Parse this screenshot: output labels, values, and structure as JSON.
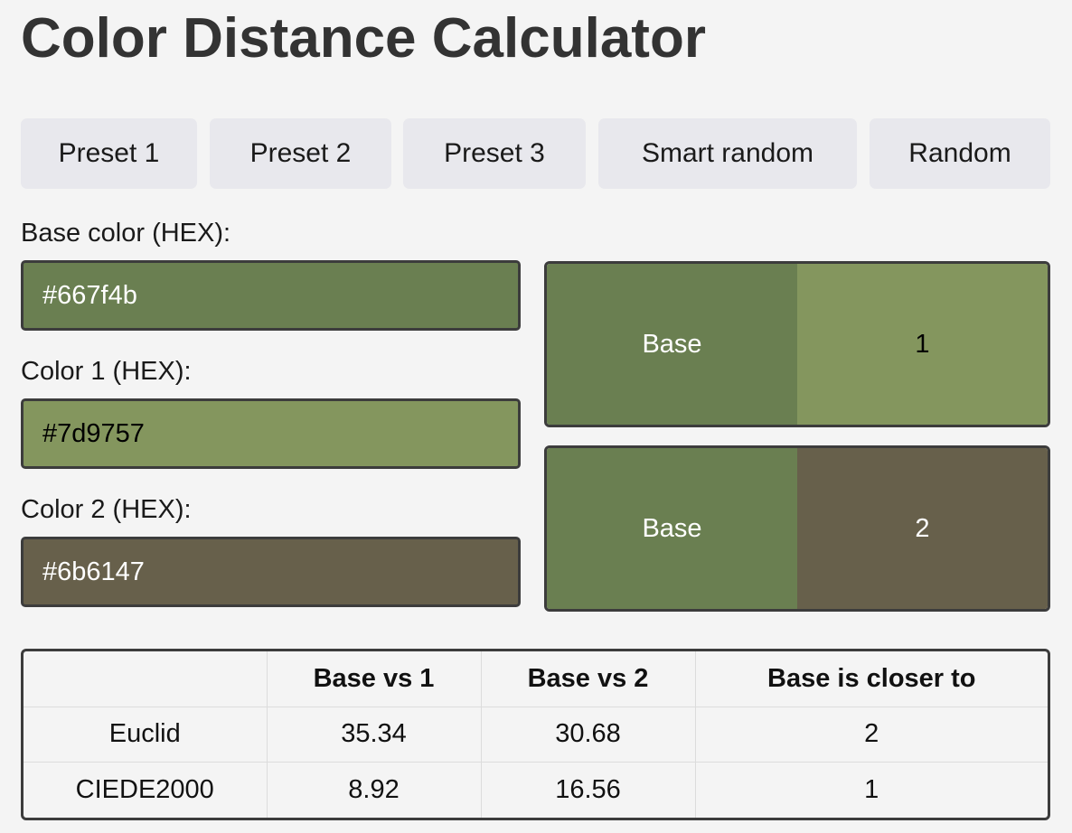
{
  "title": "Color Distance Calculator",
  "presets": {
    "preset1": "Preset 1",
    "preset2": "Preset 2",
    "preset3": "Preset 3",
    "smart_random": "Smart random",
    "random": "Random"
  },
  "inputs": {
    "base_label": "Base color (HEX):",
    "base_value": "#667f4b",
    "color1_label": "Color 1 (HEX):",
    "color1_value": "#7d9757",
    "color2_label": "Color 2 (HEX):",
    "color2_value": "#6b6147"
  },
  "colors": {
    "base": "#6a7f51",
    "color1": "#84965e",
    "color2": "#67604b",
    "base_text": "#ffffff",
    "color1_text": "#000000",
    "color2_text": "#ffffff"
  },
  "swatches": {
    "top_left": "Base",
    "top_right": "1",
    "bottom_left": "Base",
    "bottom_right": "2"
  },
  "results": {
    "headers": [
      "",
      "Base vs 1",
      "Base vs 2",
      "Base is closer to"
    ],
    "rows": [
      [
        "Euclid",
        "35.34",
        "30.68",
        "2"
      ],
      [
        "CIEDE2000",
        "8.92",
        "16.56",
        "1"
      ]
    ]
  }
}
